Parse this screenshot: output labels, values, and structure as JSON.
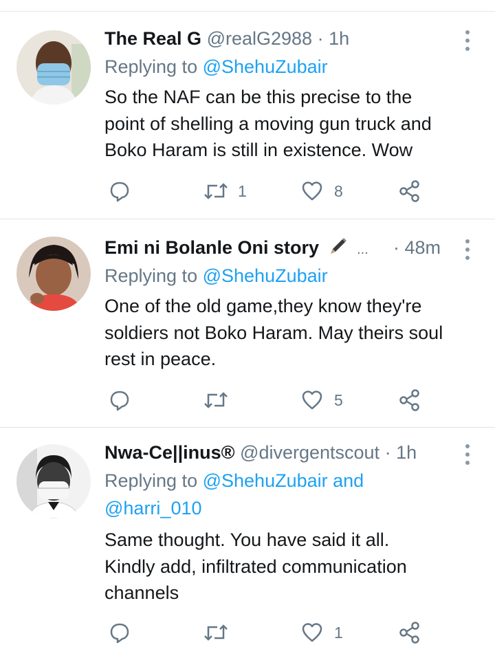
{
  "colors": {
    "name": "#14171a",
    "secondary": "#657786",
    "link": "#1da1f2",
    "divider": "#e1e8ed",
    "icon": "#657786"
  },
  "tweets": [
    {
      "display_name": "The Real G",
      "handle": "@realG2988",
      "time": "· 1h",
      "reply_prefix": "Replying to",
      "reply_line1": "@ShehuZubair",
      "reply_line2": "",
      "text_lines": [
        "So the NAF can be this precise to the",
        "point of shelling a moving gun truck and",
        "Boko Haram is still in existence. Wow"
      ],
      "reply_count": "",
      "retweet_count": "1",
      "like_count": "8",
      "avatar_icon": "avatar-face-mask"
    },
    {
      "display_name": "Emi ni Bolanle Oni story",
      "name_emoji": "pen-icon",
      "truncation": "...",
      "time": "· 48m",
      "reply_prefix": "Replying to",
      "reply_line1": "@ShehuZubair",
      "reply_line2": "",
      "text_lines": [
        "One of the old game,they know they're",
        "soldiers not Boko Haram. May theirs soul",
        "rest in peace."
      ],
      "reply_count": "",
      "retweet_count": "",
      "like_count": "5",
      "avatar_icon": "avatar-woman"
    },
    {
      "display_name": "Nwa-Ce||inus®",
      "handle": "@divergentscout",
      "time": "· 1h",
      "reply_prefix": "Replying to",
      "reply_line1": "@ShehuZubair and",
      "reply_line2": "@harri_010",
      "text_lines": [
        "Same thought. You have said it all.",
        "Kindly add, infiltrated communication",
        "channels"
      ],
      "reply_count": "",
      "retweet_count": "",
      "like_count": "1",
      "avatar_icon": "avatar-face-mask-bw"
    }
  ]
}
